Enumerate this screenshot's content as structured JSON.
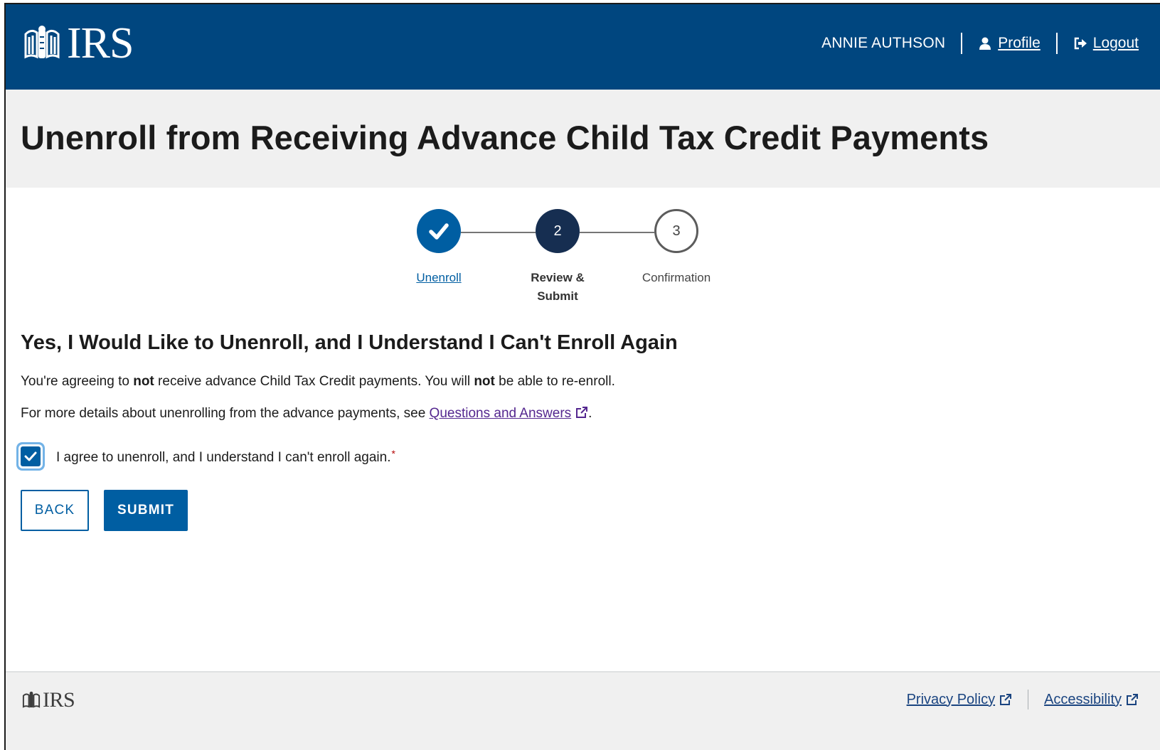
{
  "header": {
    "logo_text": "IRS",
    "user_name": "ANNIE AUTHSON",
    "profile_label": "Profile",
    "logout_label": "Logout"
  },
  "page": {
    "title": "Unenroll from Receiving Advance Child Tax Credit Payments"
  },
  "stepper": {
    "current_step": 2,
    "steps": [
      {
        "label": "Unenroll",
        "number": "1",
        "status": "complete"
      },
      {
        "label": "Review & Submit",
        "number": "2",
        "status": "current"
      },
      {
        "label": "Confirmation",
        "number": "3",
        "status": "upcoming"
      }
    ]
  },
  "content": {
    "section_title": "Yes, I Would Like to Unenroll, and I Understand I Can't Enroll Again",
    "para1": {
      "part1": "You're agreeing to ",
      "bold1": "not",
      "part2": " receive advance Child Tax Credit payments. You will ",
      "bold2": "not",
      "part3": " be able to re-enroll."
    },
    "para2": {
      "prefix": "For more details about unenrolling from the advance payments, see ",
      "link": "Questions and Answers",
      "suffix": "."
    },
    "agree_checkbox": {
      "label": "I agree to unenroll, and I understand I can't enroll again.",
      "required_marker": "*",
      "checked": true
    },
    "back_label": "BACK",
    "submit_label": "SUBMIT"
  },
  "footer": {
    "logo_text": "IRS",
    "privacy_label": "Privacy Policy",
    "accessibility_label": "Accessibility"
  },
  "colors": {
    "header_bg": "#00467f",
    "primary": "#005ea2",
    "current_step": "#162e51",
    "visited_link": "#54278f",
    "required": "#b50909"
  }
}
